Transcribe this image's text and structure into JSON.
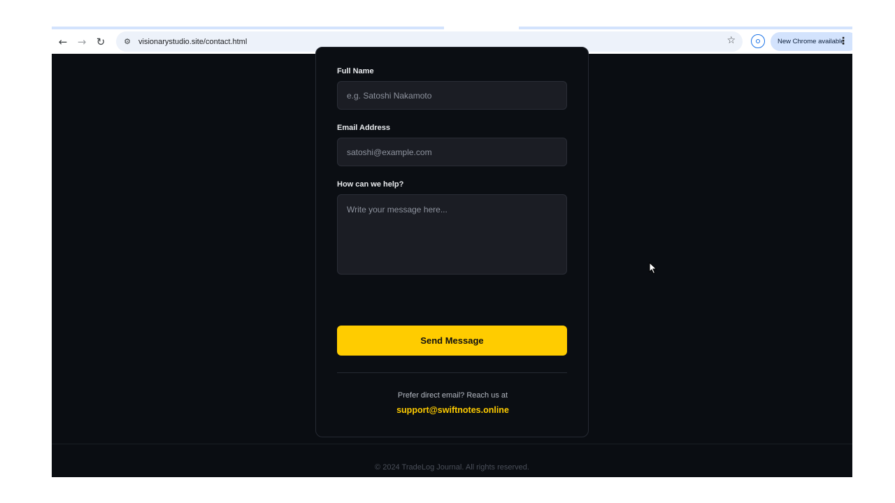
{
  "browser": {
    "url": "visionarystudio.site/contact.html",
    "update_chip": "New Chrome available",
    "back_glyph": "←",
    "forward_glyph": "→",
    "reload_glyph": "↻",
    "site_info_glyph": "⚙",
    "star_glyph": "☆",
    "menu_glyph": "⋮"
  },
  "form": {
    "name_label": "Full Name",
    "name_placeholder": "e.g. Satoshi Nakamoto",
    "email_label": "Email Address",
    "email_placeholder": "satoshi@example.com",
    "message_label": "How can we help?",
    "message_placeholder": "Write your message here...",
    "submit_label": "Send Message"
  },
  "contact": {
    "prompt": "Prefer direct email? Reach us at",
    "email": "support@swiftnotes.online"
  },
  "footer": {
    "copyright": "© 2024 TradeLog Journal. All rights reserved."
  },
  "colors": {
    "accent": "#ffcc00",
    "page_background": "#0a0d12",
    "field_background": "#1b1d24"
  }
}
